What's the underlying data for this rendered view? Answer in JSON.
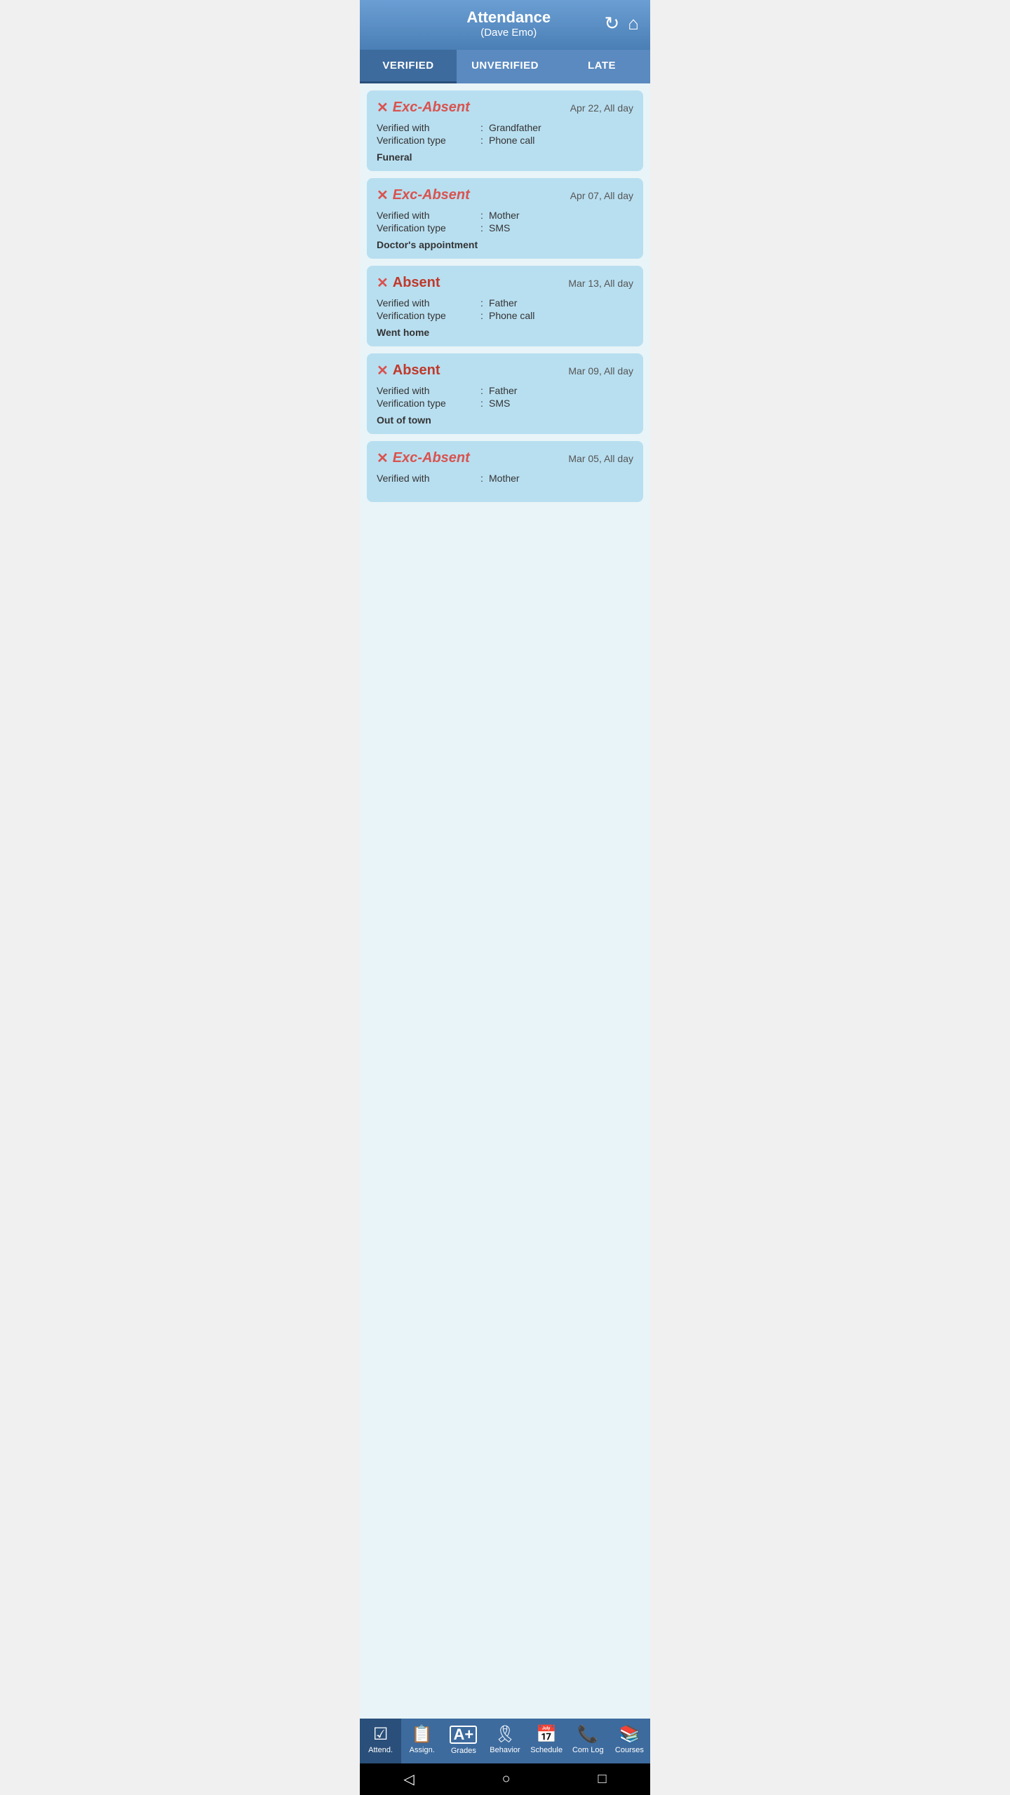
{
  "header": {
    "title": "Attendance",
    "subtitle": "(Dave Emo)",
    "refresh_icon": "↻",
    "home_icon": "⌂"
  },
  "tabs": [
    {
      "id": "verified",
      "label": "VERIFIED",
      "active": true
    },
    {
      "id": "unverified",
      "label": "UNVERIFIED",
      "active": false
    },
    {
      "id": "late",
      "label": "LATE",
      "active": false
    }
  ],
  "cards": [
    {
      "type": "Exc-Absent",
      "type_style": "exc",
      "date": "Apr 22, All day",
      "verified_with": "Grandfather",
      "verification_type": "Phone call",
      "note": "Funeral"
    },
    {
      "type": "Exc-Absent",
      "type_style": "exc",
      "date": "Apr 07, All day",
      "verified_with": "Mother",
      "verification_type": "SMS",
      "note": "Doctor's appointment"
    },
    {
      "type": "Absent",
      "type_style": "abs",
      "date": "Mar 13, All day",
      "verified_with": "Father",
      "verification_type": "Phone call",
      "note": "Went home"
    },
    {
      "type": "Absent",
      "type_style": "abs",
      "date": "Mar 09, All day",
      "verified_with": "Father",
      "verification_type": "SMS",
      "note": "Out of town"
    },
    {
      "type": "Exc-Absent",
      "type_style": "exc",
      "date": "Mar 05, All day",
      "verified_with": "Mother",
      "verification_type": "",
      "note": ""
    }
  ],
  "labels": {
    "verified_with": "Verified with",
    "verification_type": "Verification type",
    "sep": ":"
  },
  "bottom_nav": [
    {
      "id": "attend",
      "label": "Attend.",
      "icon": "☑",
      "active": true
    },
    {
      "id": "assign",
      "label": "Assign.",
      "icon": "📋",
      "active": false
    },
    {
      "id": "grades",
      "label": "Grades",
      "icon": "🅐",
      "active": false
    },
    {
      "id": "behavior",
      "label": "Behavior",
      "icon": "🎗",
      "active": false
    },
    {
      "id": "schedule",
      "label": "Schedule",
      "icon": "📅",
      "active": false
    },
    {
      "id": "comlog",
      "label": "Com Log",
      "icon": "📞",
      "active": false
    },
    {
      "id": "courses",
      "label": "Courses",
      "icon": "📚",
      "active": false
    }
  ],
  "android_nav": {
    "back": "◁",
    "home": "○",
    "recent": "□"
  }
}
